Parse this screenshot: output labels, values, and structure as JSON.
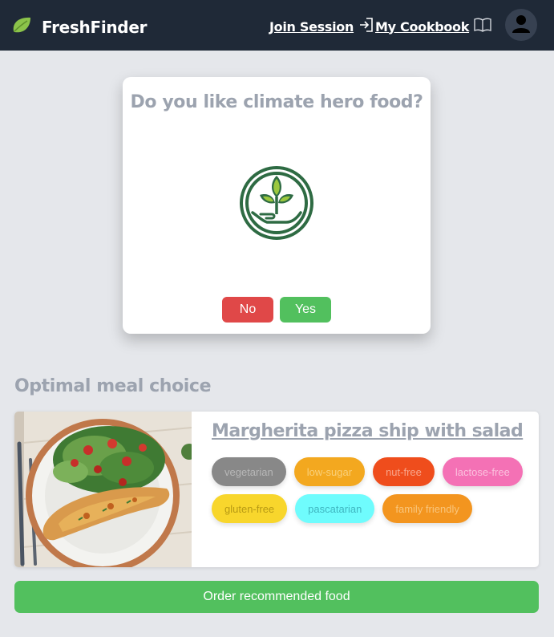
{
  "navbar": {
    "brand_name": "FreshFinder",
    "join_session_label": "Join Session",
    "cookbook_label": "My Cookbook",
    "icons": [
      "leaf-logo-icon",
      "sign-in-arrow-icon",
      "open-book-icon",
      "user-avatar-icon"
    ]
  },
  "question": {
    "title": "Do you like climate hero food?",
    "icon": "climate-hero-plant-hand-icon",
    "no_label": "No",
    "yes_label": "Yes"
  },
  "recommendation": {
    "section_title": "Optimal meal choice",
    "meal": {
      "title": "Margherita pizza ship with salad",
      "tags": [
        {
          "label": "vegetarian",
          "bg": "#888888",
          "color": "#b7b7b7"
        },
        {
          "label": "low-sugar",
          "bg": "#f3a81f",
          "color": "#f9d07a"
        },
        {
          "label": "nut-free",
          "bg": "#ef4d1c",
          "color": "#f8a58b"
        },
        {
          "label": "lactose-free",
          "bg": "#f471b5",
          "color": "#fbc1de"
        },
        {
          "label": "gluten-free",
          "bg": "#f8d62c",
          "color": "#b89a14"
        },
        {
          "label": "pascatarian",
          "bg": "#6ffcfd",
          "color": "#3fb6c0"
        },
        {
          "label": "family friendly",
          "bg": "#f3951f",
          "color": "#f9c57b"
        }
      ]
    },
    "order_label": "Order recommended food"
  },
  "colors": {
    "navbar_bg": "#1f2937",
    "page_bg": "#e5e7eb",
    "no_button": "#e04848",
    "yes_button": "#52c05e",
    "muted_text": "#9ca3af"
  }
}
